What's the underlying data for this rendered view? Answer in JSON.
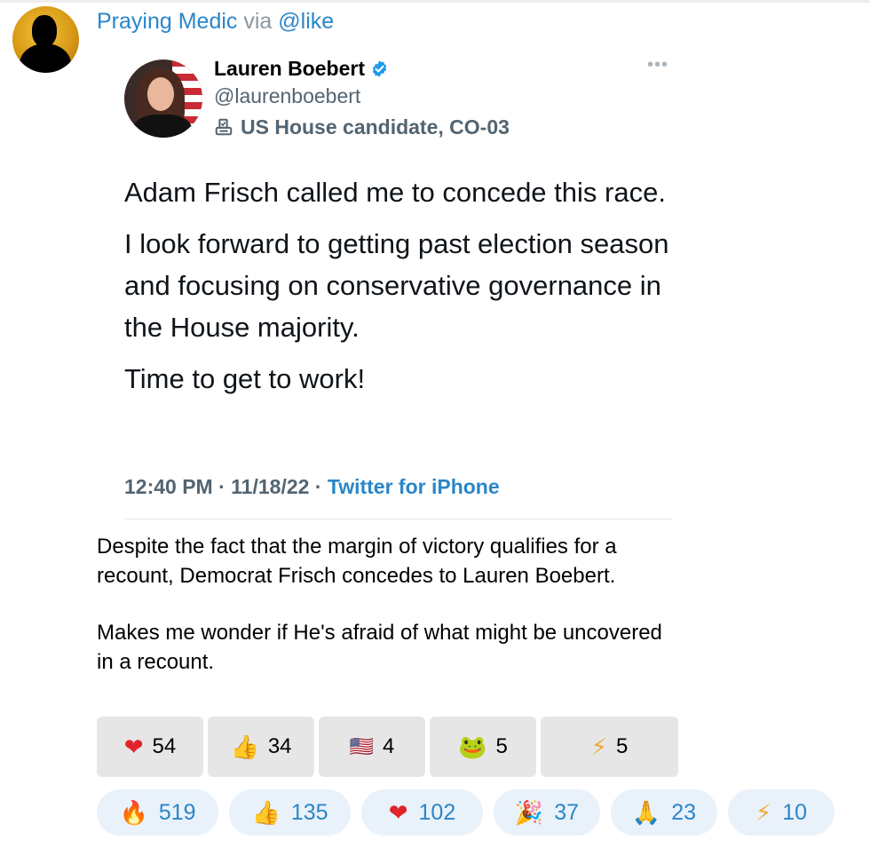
{
  "post": {
    "author": "Praying Medic",
    "via": "via",
    "bot": "@like"
  },
  "tweet": {
    "name": "Lauren Boebert",
    "handle": "@laurenboebert",
    "label": "US House candidate, CO-03",
    "body": [
      "Adam Frisch called me to concede this race.",
      "I look forward to getting past election season and focusing on conservative governance in the House majority.",
      "Time to get to work!"
    ],
    "time": "12:40 PM · 11/18/22 ·",
    "source": "Twitter for iPhone"
  },
  "caption": {
    "p1": "Despite the fact that the margin of victory  qualifies for a recount, Democrat Frisch concedes to Lauren Boebert.",
    "p2": "Makes me wonder if He's afraid of what might be uncovered in a recount."
  },
  "buttons": [
    {
      "icon": "heart-icon",
      "glyph": "❤",
      "count": "54"
    },
    {
      "icon": "thumbs-up-icon",
      "glyph": "👍",
      "count": "34"
    },
    {
      "icon": "us-flag-icon",
      "glyph": "🇺🇸",
      "count": "4"
    },
    {
      "icon": "frog-icon",
      "glyph": "🐸",
      "count": "5"
    },
    {
      "icon": "lightning-icon",
      "glyph": "⚡",
      "count": "5"
    }
  ],
  "reactions": [
    {
      "icon": "fire-icon",
      "glyph": "🔥",
      "count": "519"
    },
    {
      "icon": "thumbs-up-icon",
      "glyph": "👍",
      "count": "135"
    },
    {
      "icon": "heart-icon",
      "glyph": "❤",
      "count": "102"
    },
    {
      "icon": "party-popper-icon",
      "glyph": "🎉",
      "count": "37"
    },
    {
      "icon": "praying-hands-icon",
      "glyph": "🙏",
      "count": "23"
    },
    {
      "icon": "lightning-icon",
      "glyph": "⚡",
      "count": "10"
    }
  ],
  "colors": {
    "link": "#2a86c9",
    "muted": "#536471",
    "button_bg": "#e6e6e6",
    "pill_bg": "#e9f1fa"
  }
}
